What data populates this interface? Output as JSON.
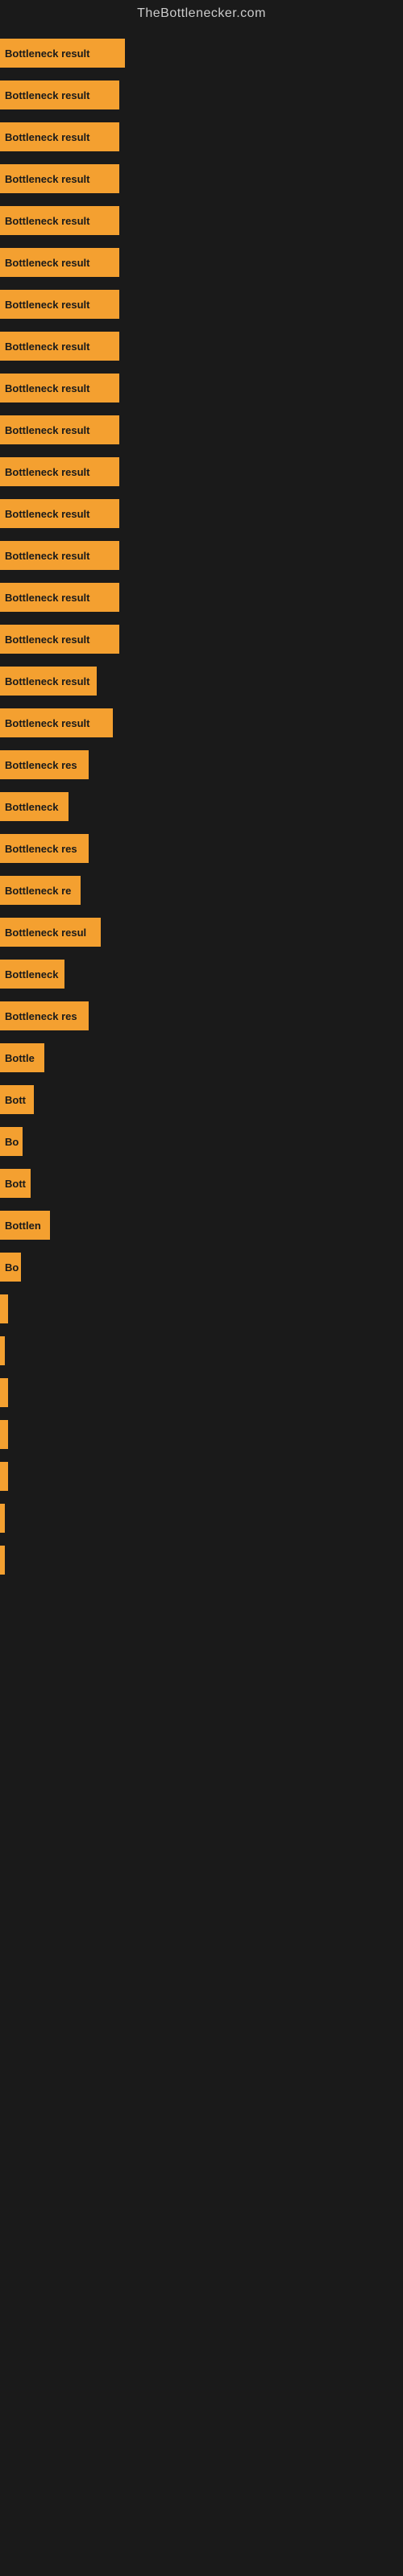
{
  "site": {
    "title": "TheBottlenecker.com"
  },
  "bars": [
    {
      "label": "Bottleneck result",
      "width": 155
    },
    {
      "label": "Bottleneck result",
      "width": 148
    },
    {
      "label": "Bottleneck result",
      "width": 148
    },
    {
      "label": "Bottleneck result",
      "width": 148
    },
    {
      "label": "Bottleneck result",
      "width": 148
    },
    {
      "label": "Bottleneck result",
      "width": 148
    },
    {
      "label": "Bottleneck result",
      "width": 148
    },
    {
      "label": "Bottleneck result",
      "width": 148
    },
    {
      "label": "Bottleneck result",
      "width": 148
    },
    {
      "label": "Bottleneck result",
      "width": 148
    },
    {
      "label": "Bottleneck result",
      "width": 148
    },
    {
      "label": "Bottleneck result",
      "width": 148
    },
    {
      "label": "Bottleneck result",
      "width": 148
    },
    {
      "label": "Bottleneck result",
      "width": 148
    },
    {
      "label": "Bottleneck result",
      "width": 148
    },
    {
      "label": "Bottleneck result",
      "width": 120
    },
    {
      "label": "Bottleneck result",
      "width": 140
    },
    {
      "label": "Bottleneck res",
      "width": 110
    },
    {
      "label": "Bottleneck",
      "width": 85
    },
    {
      "label": "Bottleneck res",
      "width": 110
    },
    {
      "label": "Bottleneck re",
      "width": 100
    },
    {
      "label": "Bottleneck resul",
      "width": 125
    },
    {
      "label": "Bottleneck",
      "width": 80
    },
    {
      "label": "Bottleneck res",
      "width": 110
    },
    {
      "label": "Bottle",
      "width": 55
    },
    {
      "label": "Bott",
      "width": 42
    },
    {
      "label": "Bo",
      "width": 28
    },
    {
      "label": "Bott",
      "width": 38
    },
    {
      "label": "Bottlen",
      "width": 62
    },
    {
      "label": "Bo",
      "width": 26
    },
    {
      "label": "",
      "width": 10
    },
    {
      "label": "",
      "width": 6
    },
    {
      "label": "",
      "width": 10
    },
    {
      "label": "",
      "width": 10
    },
    {
      "label": "",
      "width": 10
    },
    {
      "label": "",
      "width": 6
    },
    {
      "label": "",
      "width": 3
    }
  ]
}
